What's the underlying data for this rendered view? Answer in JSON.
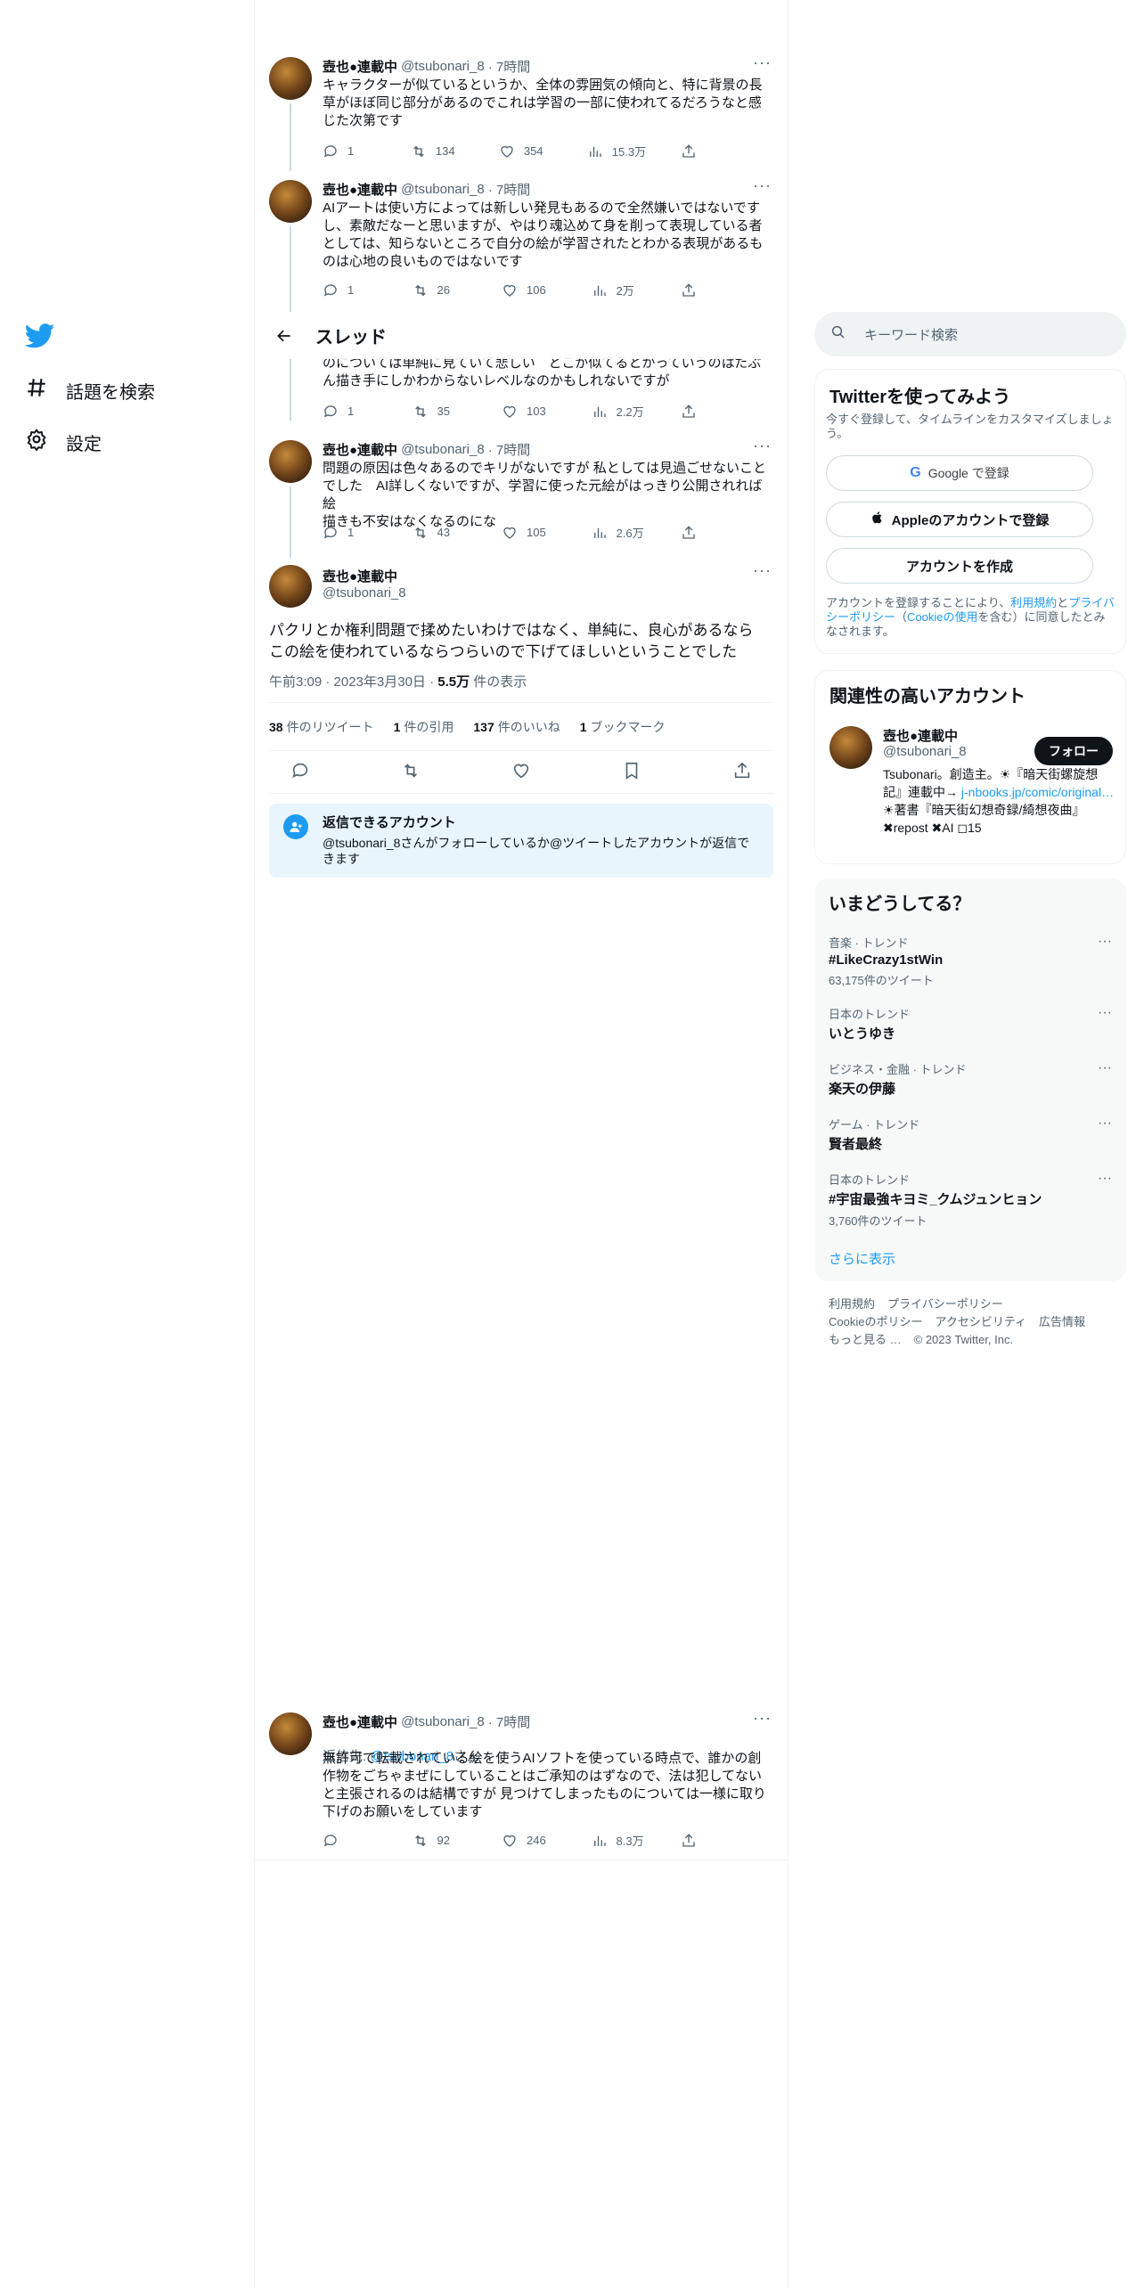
{
  "nav": {
    "items": [
      {
        "label": "話題を検索",
        "icon": "hashtag-icon"
      },
      {
        "label": "設定",
        "icon": "gear-icon"
      }
    ]
  },
  "thread": {
    "title": "スレッド"
  },
  "tweets": [
    {
      "name": "壺也●連載中",
      "handle": "@tsubonari_8",
      "time": "· 7時間",
      "body": "キャラクターが似ているというか、全体の雰囲気の傾向と、特に背景の長\n草がほぼ同じ部分があるのでこれは学習の一部に使われてるだろうなと感\nじた次第です",
      "replies": "1",
      "retweets": "134",
      "likes": "354",
      "views": "15.3万"
    },
    {
      "name": "壺也●連載中",
      "handle": "@tsubonari_8",
      "time": "· 7時間",
      "body": "AIアートは使い方によっては新しい発見もあるので全然嫌いではないです\nし、素敵だなーと思いますが、やはり魂込めて身を削って表現している者\nとしては、知らないところで自分の絵が学習されたとわかる表現があるも\nのは心地の良いものではないです",
      "replies": "1",
      "retweets": "26",
      "likes": "106",
      "views": "2万"
    },
    {
      "body": "のについては単純に見ていて悲しい　どこが似てるとかっていうのはたぶ\nん描き手にしかわからないレベルなのかもしれないですが",
      "replies": "1",
      "retweets": "35",
      "likes": "103",
      "views": "2.2万"
    },
    {
      "name": "壺也●連載中",
      "handle": "@tsubonari_8",
      "time": "· 7時間",
      "body": "問題の原因は色々あるのでキリがないですが 私としては見過ごせないこと\nでした　AI詳しくないですが、学習に使った元絵がはっきり公開されれば絵\n描きも不安はなくなるのにな",
      "replies": "1",
      "retweets": "43",
      "likes": "105",
      "views": "2.6万"
    }
  ],
  "focus": {
    "name": "壺也●連載中",
    "handle": "@tsubonari_8",
    "body": "パクリとか権利問題で揉めたいわけではなく、単純に、良心があるなら\nこの絵を使われているならつらいので下げてほしいということでした",
    "datetime": "午前3:09 · 2023年3月30日 · ",
    "views_num": "5.5万",
    "views_label": " 件の表示",
    "retweets_num": "38",
    "retweets_label": "件のリツイート",
    "quotes_num": "1",
    "quotes_label": "件の引用",
    "likes_num": "137",
    "likes_label": "件のいいね",
    "bookmarks_num": "1",
    "bookmarks_label": "ブックマーク"
  },
  "reply_restriction": {
    "title": "返信できるアカウント",
    "text": "@tsubonari_8さんがフォローしているか@ツイートしたアカウントが返信で\nきます"
  },
  "reply_tweet": {
    "name": "壺也●連載中",
    "handle": "@tsubonari_8",
    "time": "· 7時間",
    "reply_to_label": "返信先: ",
    "reply_to_handle": "@tsubonari_8",
    "reply_to_suffix": "さん",
    "body": "無許可で転載されている絵を使うAIソフトを使っている時点で、誰かの創\n作物をごちゃまぜにしていることはご承知のはずなので、法は犯してない\nと主張されるのは結構ですが 見つけてしまったものについては一様に取り\n下げのお願いをしています",
    "replies": "",
    "retweets": "92",
    "likes": "246",
    "views": "8.3万"
  },
  "sidebar": {
    "search_placeholder": "キーワード検索",
    "signup": {
      "title": "Twitterを使ってみよう",
      "subtitle": "今すぐ登録して、タイムラインをカスタマイズしましょう。",
      "google": "Google で登録",
      "apple": "Appleのアカウントで登録",
      "create": "アカウントを作成",
      "legal_1": "アカウントを登録することにより、",
      "legal_terms": "利用規約",
      "legal_2": "と",
      "legal_privacy": "プライバシーポリシー",
      "legal_3": "（",
      "legal_cookie": "Cookieの使用",
      "legal_4": "を含む）に同意したとみなされます。"
    },
    "related": {
      "title": "関連性の高いアカウント",
      "name": "壺也●連載中",
      "handle": "@tsubonari_8",
      "follow": "フォロー",
      "bio_1": "Tsubonari。創造主。☀『暗天街螺旋想記』連載中→ ",
      "bio_link": "j-nbooks.jp/comic/original…",
      "bio_2": " ☀著書『暗天街幻想奇録/綺想夜曲』 ✖repost ✖AI ◻15"
    },
    "trends": {
      "title": "いまどうしてる？",
      "items": [
        {
          "cat": "音楽 · トレンド",
          "name": "#LikeCrazy1stWin",
          "count": "63,175件のツイート"
        },
        {
          "cat": "日本のトレンド",
          "name": "いとうゆき",
          "count": ""
        },
        {
          "cat": "ビジネス・金融 · トレンド",
          "name": "楽天の伊藤",
          "count": ""
        },
        {
          "cat": "ゲーム · トレンド",
          "name": "賢者最終",
          "count": ""
        },
        {
          "cat": "日本のトレンド",
          "name": "#宇宙最強キヨミ_クムジュンヒョン",
          "count": "3,760件のツイート"
        }
      ],
      "more": "さらに表示"
    },
    "footer": {
      "links": [
        "利用規約",
        "プライバシーポリシー",
        "Cookieのポリシー",
        "アクセシビリティ",
        "広告情報",
        "もっと見る …"
      ],
      "copyright": "© 2023 Twitter, Inc."
    }
  },
  "colors": {
    "accent": "#1d9bf0",
    "text": "#0f1419",
    "muted": "#536471",
    "border": "#eff3f4"
  }
}
